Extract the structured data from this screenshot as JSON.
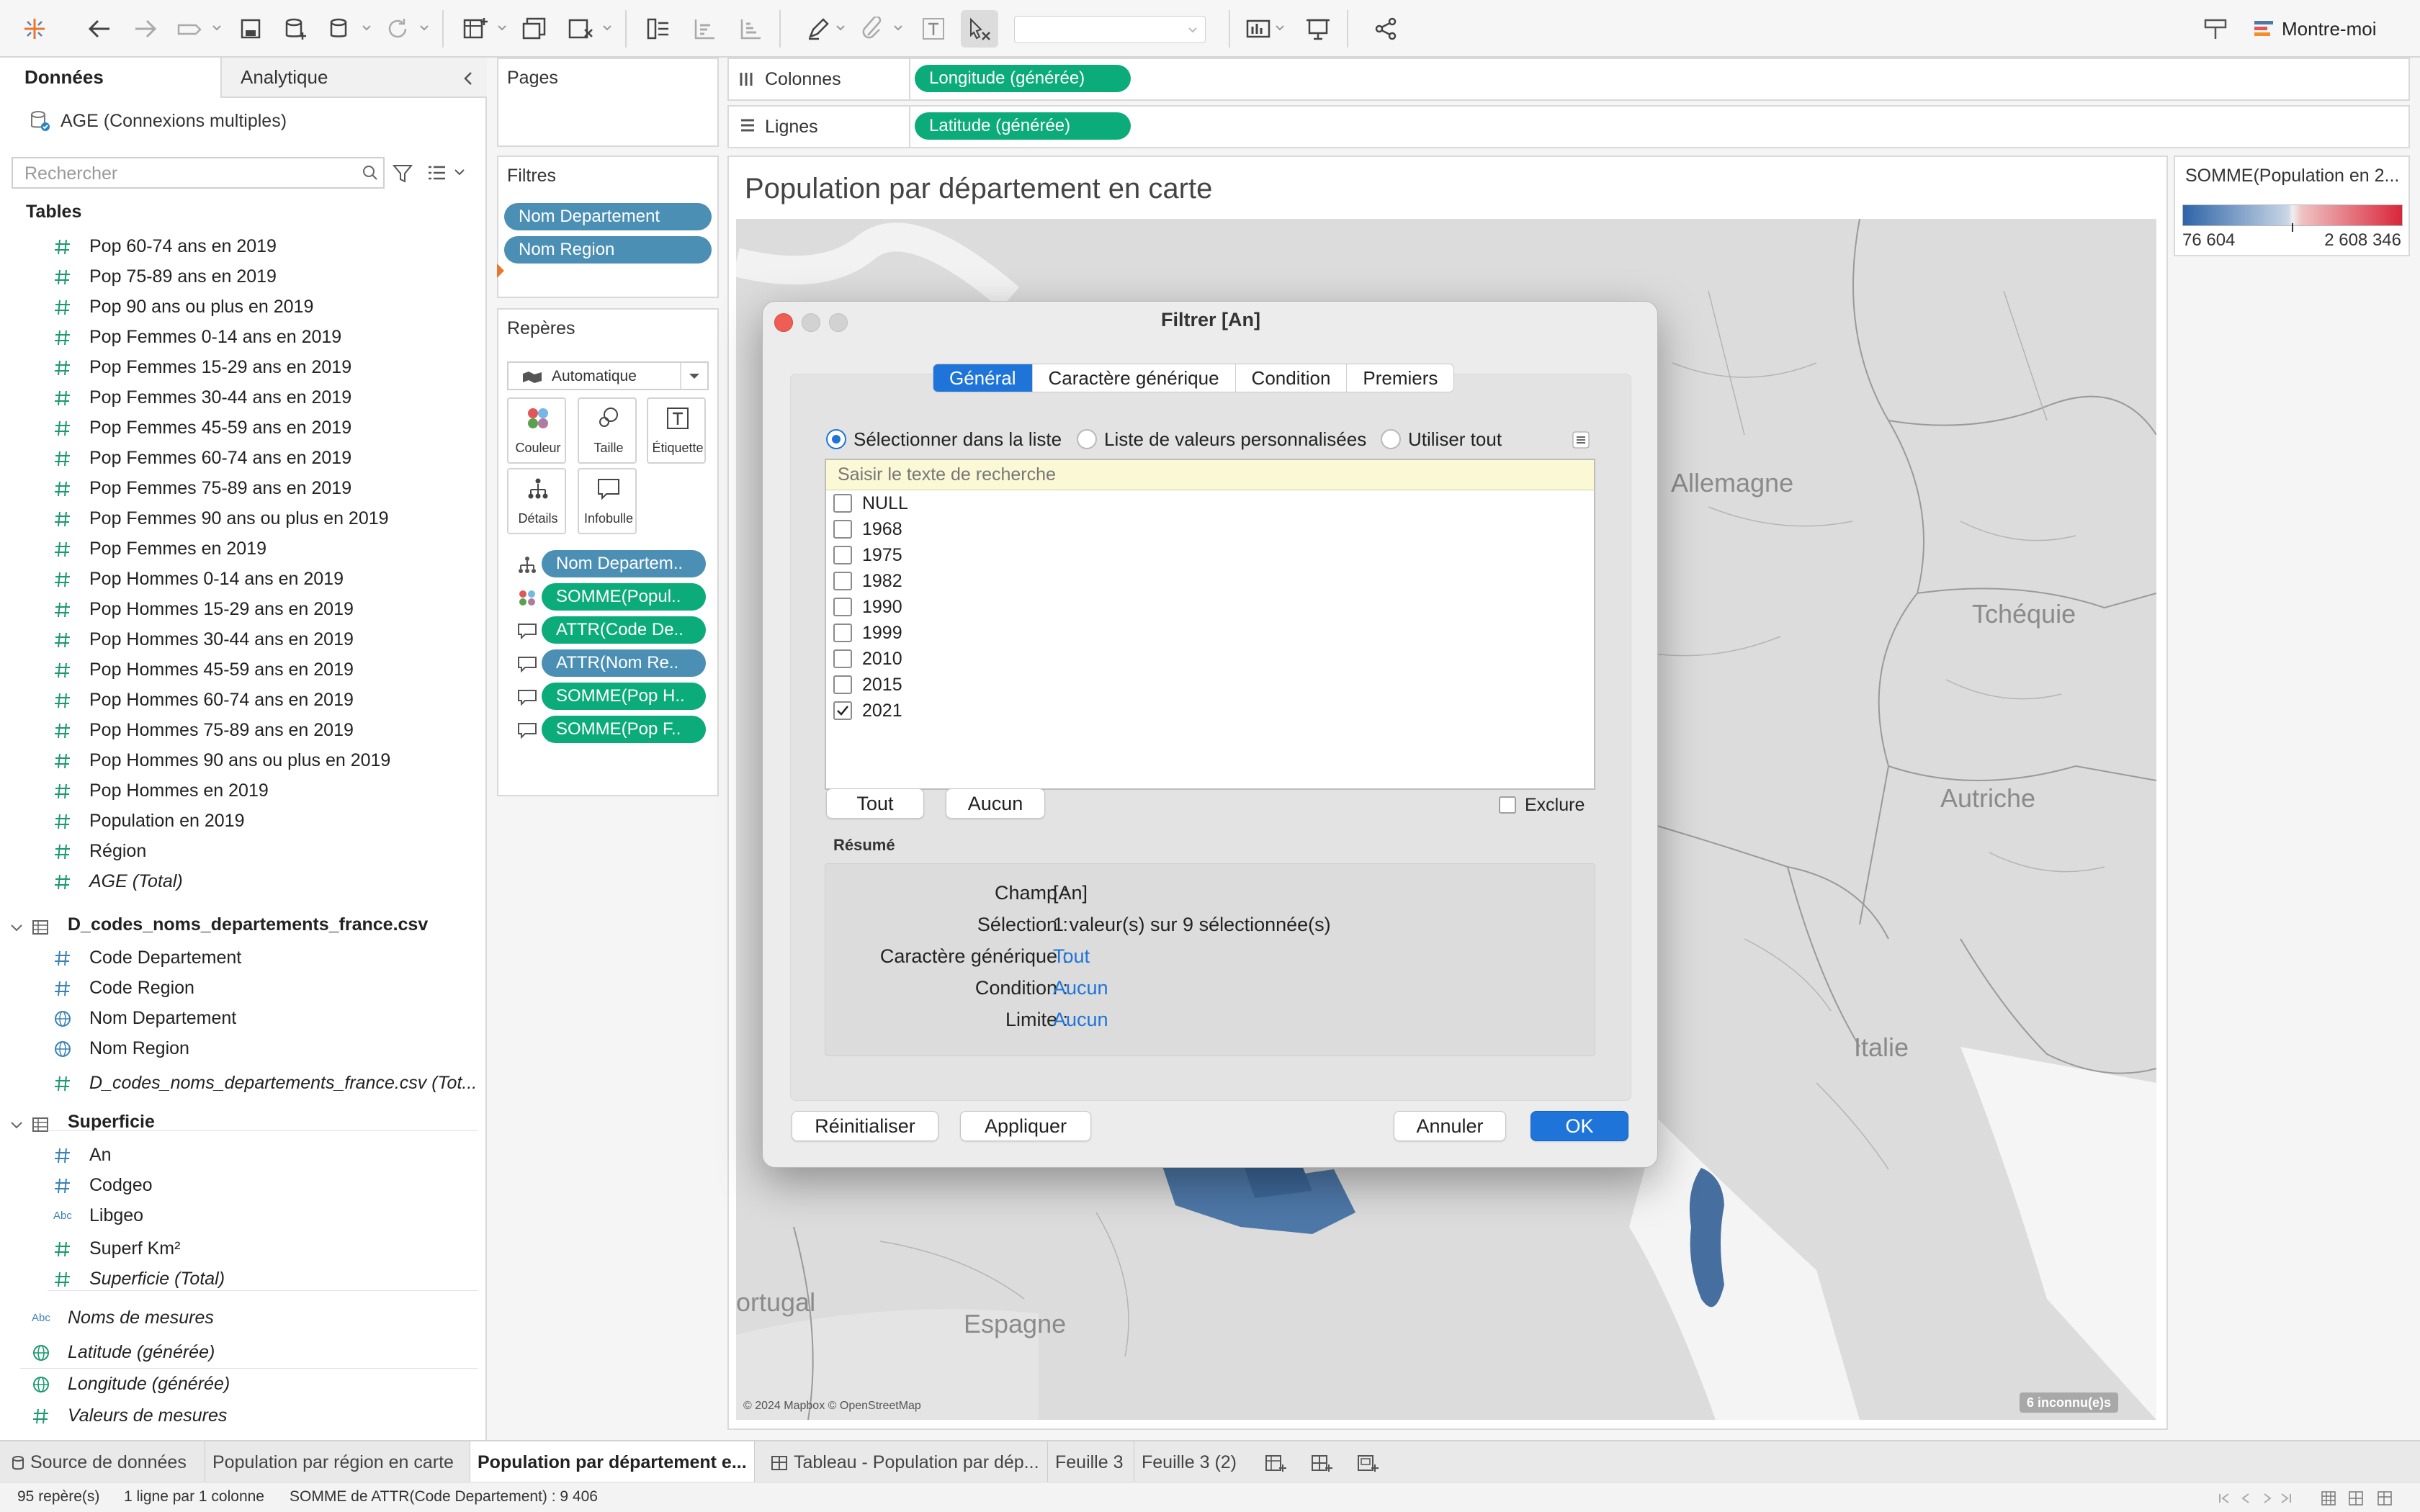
{
  "toolbar": {
    "show_me_label": "Montre-moi",
    "icons": [
      "tableau-logo-icon",
      "undo-icon",
      "redo-icon",
      "replay-icon",
      "save-icon",
      "new-datasource-icon",
      "pause-autoupdate-icon",
      "refresh-icon",
      "new-sheet-icon",
      "duplicate-sheet-icon",
      "clear-sheet-icon",
      "swap-icon",
      "sort-asc-icon",
      "sort-desc-icon",
      "highlight-icon",
      "group-icon",
      "label-icon",
      "fix-axes-icon",
      "fit-dropdown",
      "show-cards-icon",
      "presentation-icon",
      "share-icon",
      "show-me-icon"
    ]
  },
  "left_panel": {
    "tab_data": "Données",
    "tab_analytics": "Analytique",
    "datasource": "AGE (Connexions multiples)",
    "search_placeholder": "Rechercher",
    "tables_header": "Tables",
    "age_fields": [
      "Pop 60-74 ans en 2019",
      "Pop 75-89 ans en 2019",
      "Pop 90 ans ou plus en 2019",
      "Pop Femmes 0-14 ans en 2019",
      "Pop Femmes 15-29 ans en 2019",
      "Pop Femmes 30-44 ans en 2019",
      "Pop Femmes 45-59 ans en 2019",
      "Pop Femmes 60-74 ans en 2019",
      "Pop Femmes 75-89 ans en 2019",
      "Pop Femmes 90 ans ou plus en 2019",
      "Pop Femmes en 2019",
      "Pop Hommes 0-14 ans en 2019",
      "Pop Hommes 15-29 ans en 2019",
      "Pop Hommes 30-44 ans en 2019",
      "Pop Hommes 45-59 ans en 2019",
      "Pop Hommes 60-74 ans en 2019",
      "Pop Hommes 75-89 ans en 2019",
      "Pop Hommes 90 ans ou plus en 2019",
      "Pop Hommes en 2019",
      "Population en 2019",
      "Région"
    ],
    "age_total": "AGE (Total)",
    "table2_name": "D_codes_noms_departements_france.csv",
    "table2_fields": [
      "Code Departement",
      "Code Region",
      "Nom Departement",
      "Nom Region"
    ],
    "table2_total": "D_codes_noms_departements_france.csv (Tot...",
    "table3_name": "Superficie",
    "table3_fields": [
      "An",
      "Codgeo",
      "Libgeo",
      "Superf Km²"
    ],
    "table3_total": "Superficie (Total)",
    "abc_label": "Abc",
    "extra_fields": [
      "Noms de mesures",
      "Latitude (générée)",
      "Longitude (générée)",
      "Valeurs de mesures"
    ]
  },
  "pages_card": {
    "title": "Pages"
  },
  "filters_card": {
    "title": "Filtres",
    "pills": [
      "Nom Departement",
      "Nom Region"
    ]
  },
  "marks_card": {
    "title": "Repères",
    "mark_type": "Automatique",
    "buttons": [
      "Couleur",
      "Taille",
      "Étiquette",
      "Détails",
      "Infobulle"
    ],
    "pills": [
      "Nom Departem..",
      "SOMME(Popul..",
      "ATTR(Code De..",
      "ATTR(Nom Re..",
      "SOMME(Pop H..",
      "SOMME(Pop F.."
    ]
  },
  "shelves": {
    "columns_label": "Colonnes",
    "columns_pill": "Longitude (générée)",
    "rows_label": "Lignes",
    "rows_pill": "Latitude (générée)"
  },
  "viz": {
    "title": "Population par département en carte",
    "map_labels": [
      "Allemagne",
      "Tchéquie",
      "Autriche",
      "Italie",
      "Espagne",
      "ortugal"
    ],
    "map_credit": "© 2024 Mapbox © OpenStreetMap",
    "unknown_badge": "6 inconnu(e)s"
  },
  "legend": {
    "title": "SOMME(Population en 2...",
    "min": "76 604",
    "max": "2 608 346",
    "color_low": "#2e64a8",
    "color_high": "#d9263a"
  },
  "dialog": {
    "title": "Filtrer [An]",
    "tabs": [
      "Général",
      "Caractère générique",
      "Condition",
      "Premiers"
    ],
    "radio_options": [
      "Sélectionner dans la liste",
      "Liste de valeurs personnalisées",
      "Utiliser tout"
    ],
    "search_placeholder": "Saisir le texte de recherche",
    "values": [
      {
        "label": "NULL",
        "checked": false
      },
      {
        "label": "1968",
        "checked": false
      },
      {
        "label": "1975",
        "checked": false
      },
      {
        "label": "1982",
        "checked": false
      },
      {
        "label": "1990",
        "checked": false
      },
      {
        "label": "1999",
        "checked": false
      },
      {
        "label": "2010",
        "checked": false
      },
      {
        "label": "2015",
        "checked": false
      },
      {
        "label": "2021",
        "checked": true
      }
    ],
    "all_button": "Tout",
    "none_button": "Aucun",
    "exclude_label": "Exclure",
    "summary_title": "Résumé",
    "summary": [
      {
        "key": "Champ :",
        "value": "[An]",
        "link": false
      },
      {
        "key": "Sélection :",
        "value": "1 valeur(s) sur 9 sélectionnée(s)",
        "link": false
      },
      {
        "key": "Caractère générique :",
        "value": "Tout",
        "link": true
      },
      {
        "key": "Condition :",
        "value": "Aucun",
        "link": true
      },
      {
        "key": "Limite :",
        "value": "Aucun",
        "link": true
      }
    ],
    "reset_button": "Réinitialiser",
    "apply_button": "Appliquer",
    "cancel_button": "Annuler",
    "ok_button": "OK",
    "accent": "#1e74d8"
  },
  "sheet_tabs": {
    "datasource": "Source de données",
    "tabs": [
      "Population par région en carte",
      "Population par département e...",
      "Tableau - Population par dép...",
      "Feuille 3",
      "Feuille 3 (2)"
    ]
  },
  "status_bar": {
    "marks": "95 repère(s)",
    "dims": "1 ligne  par  1 colonne",
    "sum": "SOMME de ATTR(Code Departement) : 9 406"
  }
}
